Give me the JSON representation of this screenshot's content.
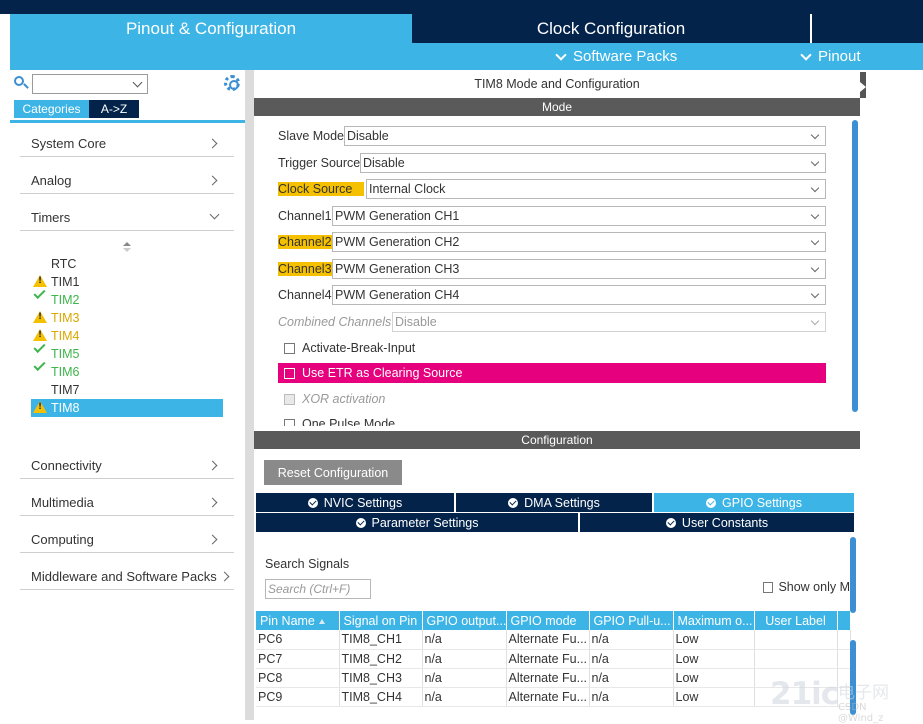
{
  "header": {
    "tabs": [
      "Pinout & Configuration",
      "Clock Configuration",
      ""
    ],
    "subbar": [
      "Software Packs",
      "Pinout"
    ]
  },
  "left": {
    "tabs": [
      "Categories",
      "A->Z"
    ],
    "categories": [
      "System Core",
      "Analog",
      "Timers",
      "Connectivity",
      "Multimedia",
      "Computing",
      "Middleware and Software Packs"
    ],
    "timers": [
      {
        "label": "RTC",
        "status": "none"
      },
      {
        "label": "TIM1",
        "status": "warning"
      },
      {
        "label": "TIM2",
        "status": "ok"
      },
      {
        "label": "TIM3",
        "status": "warning"
      },
      {
        "label": "TIM4",
        "status": "warning"
      },
      {
        "label": "TIM5",
        "status": "ok"
      },
      {
        "label": "TIM6",
        "status": "ok"
      },
      {
        "label": "TIM7",
        "status": "none"
      },
      {
        "label": "TIM8",
        "status": "warning-selected"
      }
    ]
  },
  "main": {
    "title": "TIM8 Mode and Configuration",
    "mode_header": "Mode",
    "config_header": "Configuration",
    "mode_rows": [
      {
        "label": "Slave Mode",
        "value": "Disable"
      },
      {
        "label": "Trigger Source",
        "value": "Disable"
      },
      {
        "label": "Clock Source",
        "value": "Internal Clock"
      },
      {
        "label": "Channel1",
        "value": "PWM Generation CH1"
      },
      {
        "label": "Channel2",
        "value": "PWM Generation CH2"
      },
      {
        "label": "Channel3",
        "value": "PWM Generation CH3"
      },
      {
        "label": "Channel4",
        "value": "PWM Generation CH4"
      },
      {
        "label": "Combined Channels",
        "value": "Disable"
      }
    ],
    "checkboxes": [
      "Activate-Break-Input",
      "Use ETR as Clearing Source",
      "XOR activation",
      "One Pulse Mode"
    ],
    "reset_button": "Reset Configuration",
    "param_tabs_row1": [
      "NVIC Settings",
      "DMA Settings",
      "GPIO Settings"
    ],
    "param_tabs_row2": [
      "Parameter Settings",
      "User Constants"
    ],
    "search_label": "Search Signals",
    "search_placeholder": "Search (Ctrl+F)",
    "show_only": "Show only M",
    "table": {
      "headers": [
        "Pin Name",
        "Signal on Pin",
        "GPIO output...",
        "GPIO mode",
        "GPIO Pull-u...",
        "Maximum o...",
        "User Label",
        ""
      ],
      "rows": [
        [
          "PC6",
          "TIM8_CH1",
          "n/a",
          "Alternate Fu...",
          "n/a",
          "Low",
          ""
        ],
        [
          "PC7",
          "TIM8_CH2",
          "n/a",
          "Alternate Fu...",
          "n/a",
          "Low",
          ""
        ],
        [
          "PC8",
          "TIM8_CH3",
          "n/a",
          "Alternate Fu...",
          "n/a",
          "Low",
          ""
        ],
        [
          "PC9",
          "TIM8_CH4",
          "n/a",
          "Alternate Fu...",
          "n/a",
          "Low",
          ""
        ]
      ]
    }
  },
  "watermark": {
    "big": "21ic",
    "cn": "电子网",
    "small": "CSDN @Wind_z"
  },
  "colors": {
    "accent": "#3cb4e6",
    "navy": "#03234b",
    "highlight": "#f5c000",
    "etr": "#e6007e",
    "ok": "#3db54a"
  }
}
